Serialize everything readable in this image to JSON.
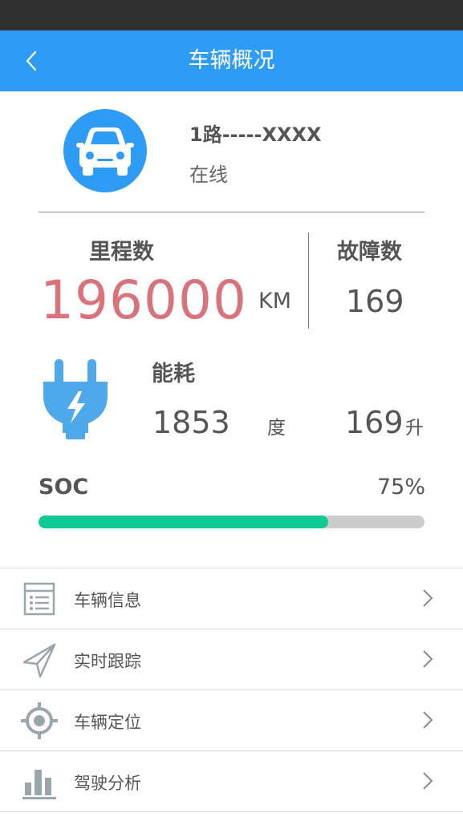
{
  "header": {
    "title": "车辆概况"
  },
  "vehicle": {
    "plate": "1路-----XXXX",
    "status": "在线"
  },
  "stats": {
    "mileage_label": "里程数",
    "mileage_value": "196000",
    "mileage_unit": "KM",
    "fault_label": "故障数",
    "fault_value": "169"
  },
  "energy": {
    "label": "能耗",
    "value": "1853",
    "unit": "度",
    "liter_value": "169",
    "liter_unit": "升"
  },
  "soc": {
    "label": "SOC",
    "value_text": "75%",
    "fraction": 0.75
  },
  "menu": [
    {
      "label": "车辆信息",
      "icon": "list-icon"
    },
    {
      "label": "实时跟踪",
      "icon": "paper-plane-icon"
    },
    {
      "label": "车辆定位",
      "icon": "locate-icon"
    },
    {
      "label": "驾驶分析",
      "icon": "bar-chart-icon"
    }
  ],
  "colors": {
    "primary": "#2e9bf4",
    "mileage": "#d9727a",
    "soc_fill": "#10c994",
    "soc_track": "#cccccc",
    "statusbar": "#2f2f2f"
  }
}
